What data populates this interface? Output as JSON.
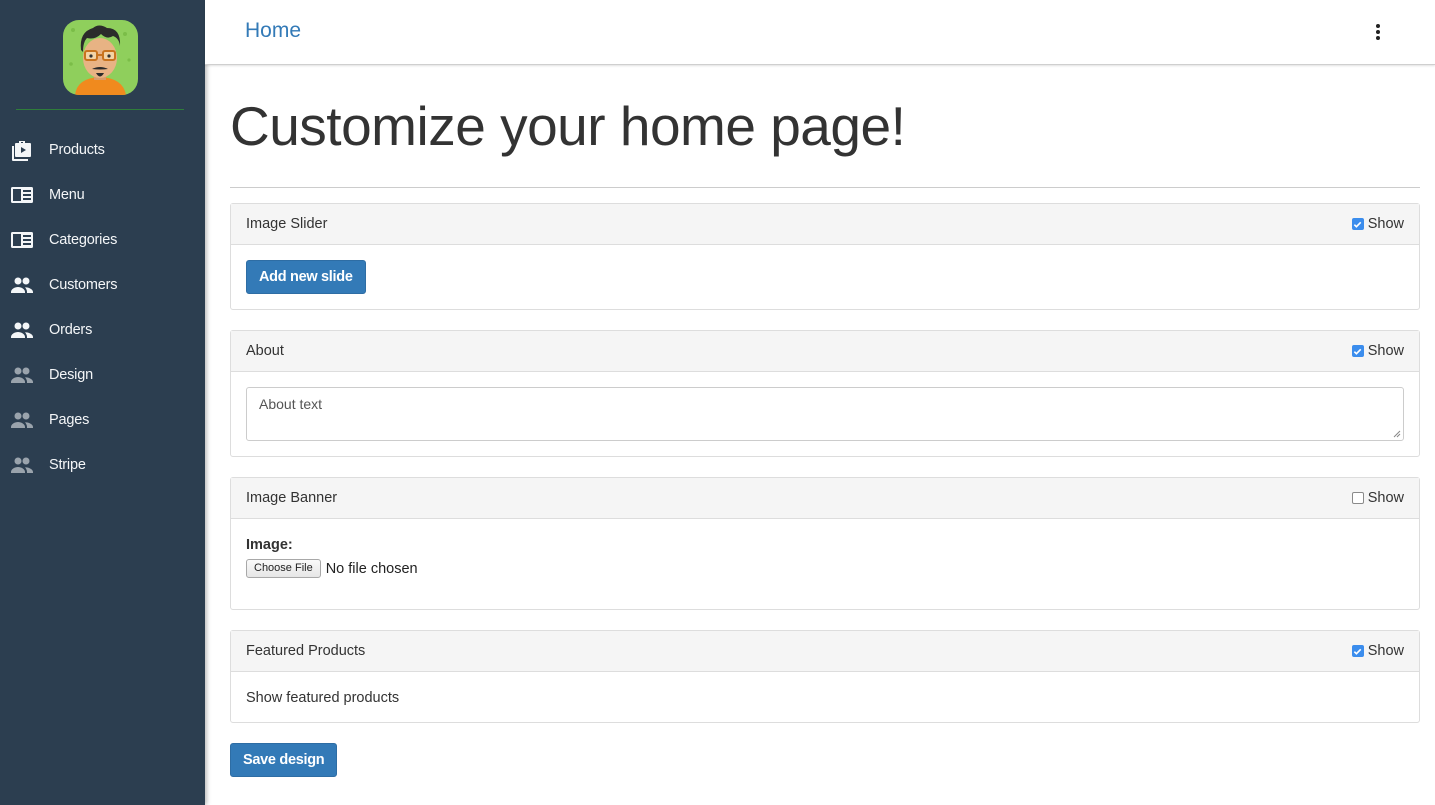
{
  "sidebar": {
    "items": [
      {
        "label": "Products",
        "icon": "briefcase-play-icon"
      },
      {
        "label": "Menu",
        "icon": "menu-card-icon"
      },
      {
        "label": "Categories",
        "icon": "categories-card-icon"
      },
      {
        "label": "Customers",
        "icon": "people-icon"
      },
      {
        "label": "Orders",
        "icon": "people-icon"
      },
      {
        "label": "Design",
        "icon": "people-icon"
      },
      {
        "label": "Pages",
        "icon": "people-icon"
      },
      {
        "label": "Stripe",
        "icon": "people-icon"
      }
    ]
  },
  "header": {
    "title": "Home",
    "menu_icon": "more-vertical-icon"
  },
  "main": {
    "title": "Customize your home page!",
    "sections": {
      "image_slider": {
        "title": "Image Slider",
        "show_label": "Show",
        "show_checked": true,
        "add_button": "Add new slide"
      },
      "about": {
        "title": "About",
        "show_label": "Show",
        "show_checked": true,
        "text_value": "About text"
      },
      "image_banner": {
        "title": "Image Banner",
        "show_label": "Show",
        "show_checked": false,
        "image_label": "Image:",
        "choose_file": "Choose File",
        "file_status": "No file chosen"
      },
      "featured_products": {
        "title": "Featured Products",
        "show_label": "Show",
        "show_checked": true,
        "body_text": "Show featured products"
      }
    },
    "save_button": "Save design"
  },
  "colors": {
    "sidebar_bg": "#2c3e50",
    "primary": "#337ab7",
    "checkbox_on": "#3b8ded"
  }
}
